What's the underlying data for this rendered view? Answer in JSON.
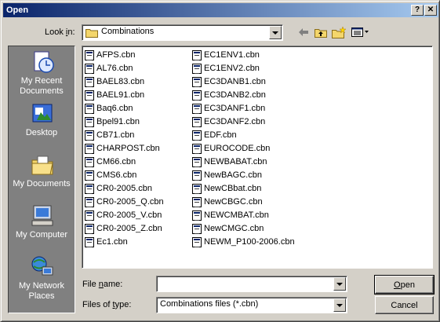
{
  "window": {
    "title": "Open",
    "help_label": "?",
    "close_label": "✕"
  },
  "look_in": {
    "label_pre": "Look ",
    "label_key": "i",
    "label_post": "n:",
    "value": "Combinations"
  },
  "toolbar": {
    "back_icon": "back-arrow-icon",
    "up_icon": "up-folder-icon",
    "new_folder_icon": "new-folder-icon",
    "views_icon": "views-menu-icon"
  },
  "places": [
    {
      "name": "recent",
      "label_line1": "My Recent",
      "label_line2": "Documents"
    },
    {
      "name": "desktop",
      "label_line1": "Desktop",
      "label_line2": ""
    },
    {
      "name": "documents",
      "label_line1": "My Documents",
      "label_line2": ""
    },
    {
      "name": "computer",
      "label_line1": "My Computer",
      "label_line2": ""
    },
    {
      "name": "network",
      "label_line1": "My Network",
      "label_line2": "Places"
    }
  ],
  "files_col1": [
    "AFPS.cbn",
    "AL76.cbn",
    "BAEL83.cbn",
    "BAEL91.cbn",
    "Baq6.cbn",
    "Bpel91.cbn",
    "CB71.cbn",
    "CHARPOST.cbn",
    "CM66.cbn",
    "CMS6.cbn",
    "CR0-2005.cbn",
    "CR0-2005_Q.cbn",
    "CR0-2005_V.cbn",
    "CR0-2005_Z.cbn",
    "Ec1.cbn"
  ],
  "files_col2": [
    "EC1ENV1.cbn",
    "EC1ENV2.cbn",
    "EC3DANB1.cbn",
    "EC3DANB2.cbn",
    "EC3DANF1.cbn",
    "EC3DANF2.cbn",
    "EDF.cbn",
    "EUROCODE.cbn",
    "NEWBABAT.cbn",
    "NewBAGC.cbn",
    "NewCBbat.cbn",
    "NewCBGC.cbn",
    "NEWCMBAT.cbn",
    "NewCMGC.cbn",
    "NEWM_P100-2006.cbn"
  ],
  "file_name": {
    "label_pre": "File ",
    "label_key": "n",
    "label_post": "ame:",
    "value": ""
  },
  "file_type": {
    "label_pre": "Files of ",
    "label_key": "t",
    "label_post": "ype:",
    "value": "Combinations files (*.cbn)"
  },
  "buttons": {
    "open_key": "O",
    "open_rest": "pen",
    "cancel": "Cancel"
  }
}
